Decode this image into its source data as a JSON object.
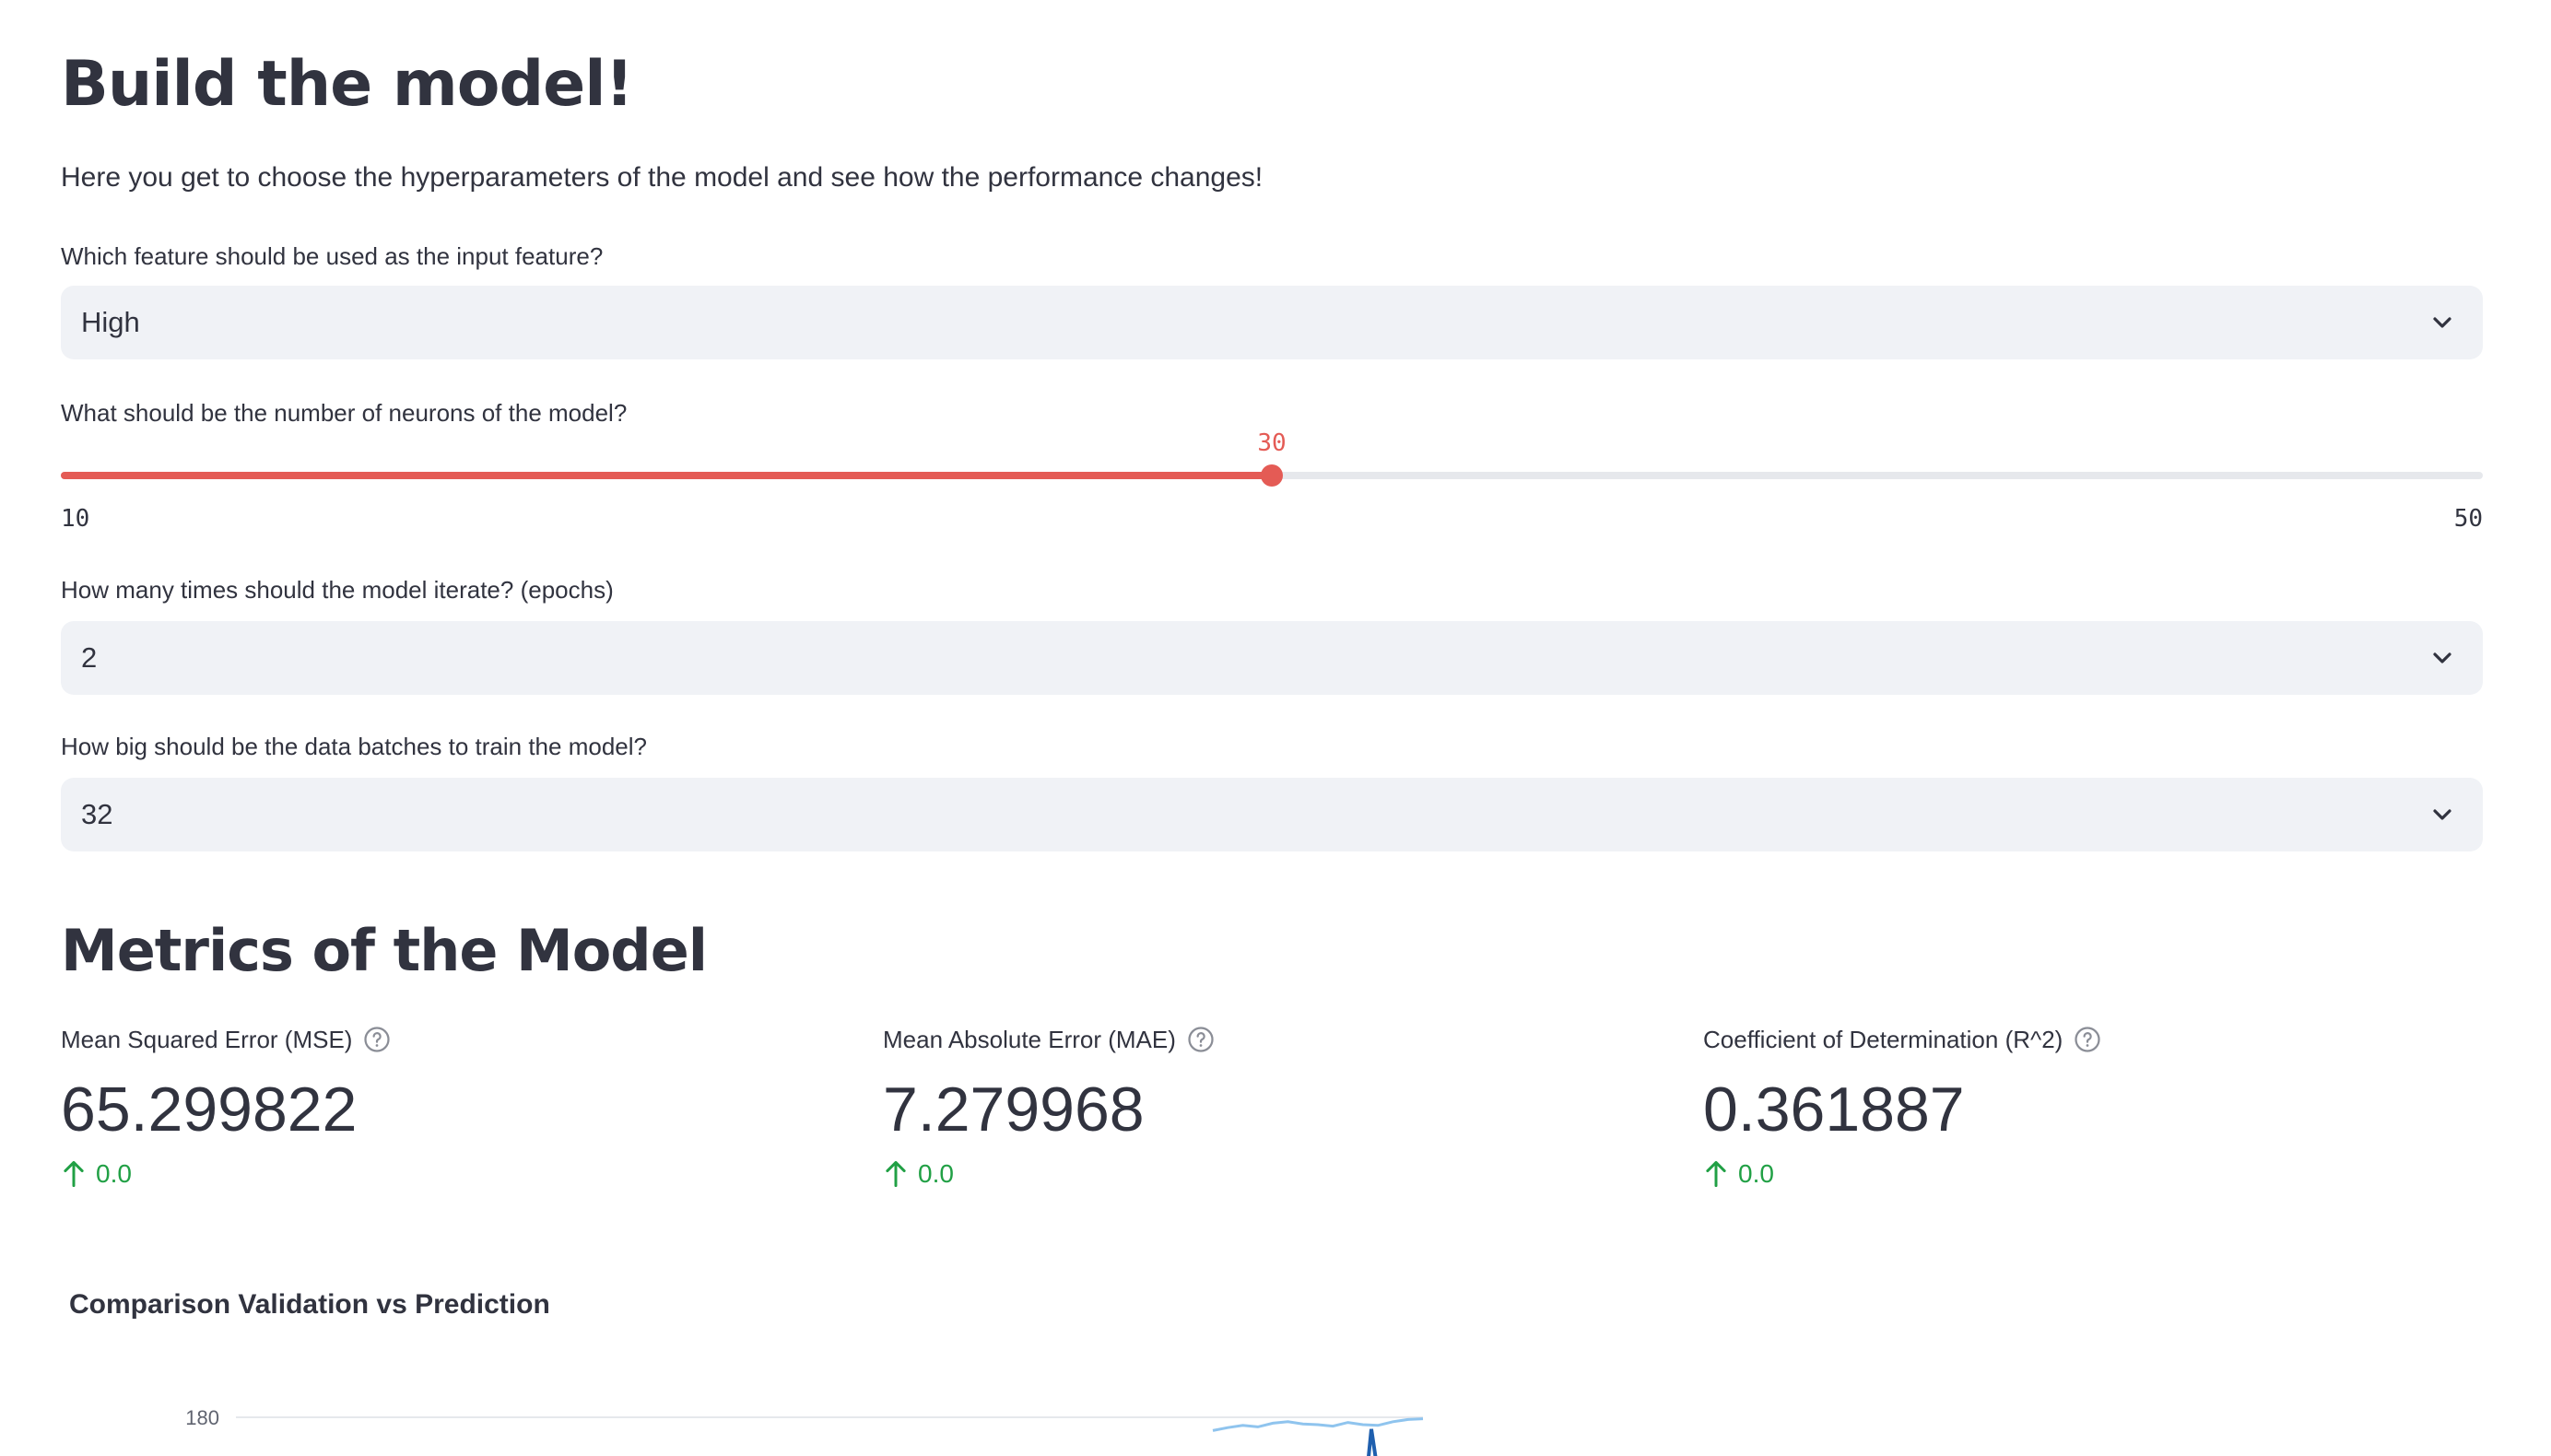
{
  "header": {
    "title": "Build the model!",
    "intro": "Here you get to choose the hyperparameters of the model and see how the performance changes!"
  },
  "feature_select": {
    "label": "Which feature should be used as the input feature?",
    "value": "High"
  },
  "neurons_slider": {
    "label": "What should be the number of neurons of the model?",
    "min": 10,
    "max": 50,
    "value": 30,
    "min_label": "10",
    "max_label": "50",
    "value_label": "30"
  },
  "epochs_select": {
    "label": "How many times should the model iterate? (epochs)",
    "value": "2"
  },
  "batch_select": {
    "label": "How big should be the data batches to train the model?",
    "value": "32"
  },
  "metrics": {
    "title": "Metrics of the Model",
    "items": [
      {
        "label": "Mean Squared Error (MSE)",
        "value": "65.299822",
        "delta": "0.0"
      },
      {
        "label": "Mean Absolute Error (MAE)",
        "value": "7.279968",
        "delta": "0.0"
      },
      {
        "label": "Coefficient of Determination (R^2)",
        "value": "0.361887",
        "delta": "0.0"
      }
    ]
  },
  "colors": {
    "accent": "#e45b55",
    "delta_positive": "#21a045",
    "input_bg": "#f0f2f6",
    "text": "#31333f",
    "series_validation": "#8fc4ee",
    "series_prediction": "#1f5fae"
  },
  "icons": {
    "select": "chevron-down-icon",
    "help": "question-circle-icon",
    "delta": "arrow-up-icon"
  },
  "chart_data": {
    "type": "line",
    "title": "Comparison Validation vs Prediction",
    "y_tick_labels": [
      "180"
    ],
    "y_ticks": [
      180
    ],
    "ylim": [
      170,
      180
    ],
    "x_visible_fraction": [
      0,
      1
    ],
    "series": [
      {
        "values": [
          178.2,
          178.6,
          178.9,
          178.7,
          179.2,
          179.4,
          179.1,
          179.0,
          178.8,
          179.3,
          179.0,
          178.9,
          179.4,
          179.7,
          179.8
        ]
      },
      {
        "values": [
          178.4
        ]
      }
    ],
    "grid": true
  }
}
